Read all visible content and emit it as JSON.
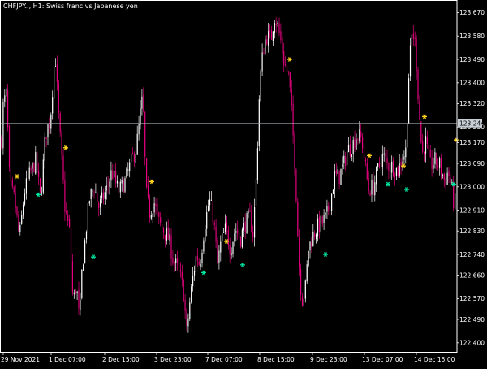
{
  "header": {
    "title": "CHFJPY.., H1:  Swiss franc vs Japanese yen"
  },
  "colors": {
    "background": "#000000",
    "frame": "#ffffff",
    "bull_candle": "#ffffff",
    "bear_candle": "#e6007e",
    "buy_arrow": "#00e5a0",
    "sell_arrow": "#ffd21f",
    "price_line": "#a0a8b0",
    "price_tag_bg": "#c8ced6",
    "price_tag_text": "#000000"
  },
  "chart_data": {
    "type": "candlestick",
    "symbol": "CHFJPY..",
    "timeframe": "H1",
    "ylim": [
      122.365,
      123.715
    ],
    "y_ticks": [
      "123.670",
      "123.580",
      "123.490",
      "123.400",
      "123.320",
      "123.230",
      "123.170",
      "123.090",
      "123.000",
      "122.910",
      "122.830",
      "122.740",
      "122.660",
      "122.570",
      "122.490",
      "122.400"
    ],
    "x_ticks": [
      "29 Nov 2021",
      "1 Dec 07:00",
      "2 Dec 15:00",
      "3 Dec 23:00",
      "7 Dec 07:00",
      "8 Dec 15:00",
      "9 Dec 23:00",
      "13 Dec 07:00",
      "14 Dec 15:00"
    ],
    "current_price": "123.244",
    "close_path": [
      [
        0,
        122.95
      ],
      [
        3,
        123.3
      ],
      [
        8,
        123.36
      ],
      [
        12,
        123.0
      ],
      [
        18,
        122.95
      ],
      [
        24,
        122.8
      ],
      [
        30,
        122.98
      ],
      [
        37,
        123.05
      ],
      [
        44,
        123.1
      ],
      [
        50,
        122.95
      ],
      [
        56,
        123.2
      ],
      [
        62,
        123.26
      ],
      [
        68,
        123.52
      ],
      [
        72,
        123.28
      ],
      [
        80,
        122.92
      ],
      [
        86,
        122.82
      ],
      [
        90,
        122.55
      ],
      [
        94,
        122.63
      ],
      [
        98,
        122.47
      ],
      [
        101,
        122.68
      ],
      [
        105,
        122.8
      ],
      [
        110,
        122.95
      ],
      [
        116,
        123.0
      ],
      [
        122,
        122.92
      ],
      [
        130,
        122.98
      ],
      [
        138,
        123.06
      ],
      [
        146,
        122.98
      ],
      [
        154,
        123.02
      ],
      [
        162,
        123.1
      ],
      [
        168,
        123.15
      ],
      [
        173,
        123.28
      ],
      [
        176,
        123.35
      ],
      [
        180,
        122.98
      ],
      [
        184,
        122.9
      ],
      [
        190,
        122.94
      ],
      [
        196,
        122.86
      ],
      [
        202,
        122.83
      ],
      [
        208,
        122.8
      ],
      [
        214,
        122.71
      ],
      [
        220,
        122.68
      ],
      [
        226,
        122.6
      ],
      [
        230,
        122.44
      ],
      [
        234,
        122.56
      ],
      [
        238,
        122.66
      ],
      [
        242,
        122.74
      ],
      [
        246,
        122.7
      ],
      [
        252,
        122.85
      ],
      [
        258,
        122.95
      ],
      [
        263,
        122.88
      ],
      [
        268,
        122.7
      ],
      [
        272,
        122.78
      ],
      [
        278,
        122.84
      ],
      [
        284,
        122.76
      ],
      [
        290,
        122.84
      ],
      [
        296,
        122.8
      ],
      [
        302,
        122.86
      ],
      [
        308,
        122.88
      ],
      [
        312,
        122.82
      ],
      [
        316,
        123.05
      ],
      [
        320,
        123.4
      ],
      [
        324,
        123.52
      ],
      [
        328,
        123.58
      ],
      [
        334,
        123.57
      ],
      [
        338,
        123.66
      ],
      [
        342,
        123.62
      ],
      [
        346,
        123.56
      ],
      [
        350,
        123.48
      ],
      [
        356,
        123.42
      ],
      [
        360,
        123.25
      ],
      [
        364,
        123.05
      ],
      [
        368,
        122.72
      ],
      [
        372,
        122.56
      ],
      [
        376,
        122.6
      ],
      [
        380,
        122.76
      ],
      [
        384,
        122.8
      ],
      [
        390,
        122.84
      ],
      [
        396,
        122.86
      ],
      [
        402,
        122.88
      ],
      [
        408,
        122.96
      ],
      [
        412,
        123.04
      ],
      [
        418,
        123.04
      ],
      [
        424,
        123.09
      ],
      [
        428,
        123.14
      ],
      [
        434,
        123.16
      ],
      [
        440,
        123.2
      ],
      [
        446,
        123.18
      ],
      [
        450,
        123.08
      ],
      [
        454,
        122.99
      ],
      [
        460,
        123.0
      ],
      [
        466,
        123.07
      ],
      [
        472,
        123.12
      ],
      [
        478,
        123.08
      ],
      [
        484,
        123.08
      ],
      [
        490,
        123.06
      ],
      [
        494,
        123.1
      ],
      [
        500,
        123.14
      ],
      [
        504,
        123.46
      ],
      [
        508,
        123.6
      ],
      [
        512,
        123.54
      ],
      [
        516,
        123.3
      ],
      [
        520,
        123.12
      ],
      [
        524,
        123.18
      ],
      [
        530,
        123.08
      ],
      [
        536,
        123.1
      ],
      [
        542,
        123.08
      ],
      [
        548,
        123.02
      ],
      [
        552,
        123.06
      ],
      [
        556,
        123.0
      ],
      [
        560,
        122.92
      ],
      [
        563,
        123.02
      ]
    ],
    "markers": [
      {
        "kind": "sell",
        "price": 123.04
      },
      {
        "kind": "buy",
        "price": 122.97
      },
      {
        "kind": "sell",
        "price": 123.15
      },
      {
        "kind": "buy",
        "price": 122.73
      },
      {
        "kind": "sell",
        "price": 123.02
      },
      {
        "kind": "buy",
        "price": 122.67
      },
      {
        "kind": "sell",
        "price": 122.79
      },
      {
        "kind": "buy",
        "price": 122.7
      },
      {
        "kind": "sell",
        "price": 123.49
      },
      {
        "kind": "buy",
        "price": 122.74
      },
      {
        "kind": "sell",
        "price": 123.12
      },
      {
        "kind": "buy",
        "price": 123.01
      },
      {
        "kind": "sell",
        "price": 123.08
      },
      {
        "kind": "buy",
        "price": 122.99
      },
      {
        "kind": "sell",
        "price": 123.27
      },
      {
        "kind": "sell",
        "price": 123.18
      },
      {
        "kind": "buy",
        "price": 123.01
      }
    ]
  }
}
